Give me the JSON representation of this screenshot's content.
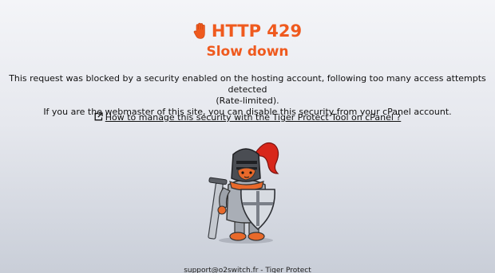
{
  "header": {
    "title": "HTTP 429",
    "subtitle": "Slow down",
    "icon": "hand-stop-icon",
    "accent_color": "#ef5a1e"
  },
  "message": {
    "line1": "This request was blocked by a security enabled on the hosting account, following too many access attempts detected",
    "line2": "(Rate-limited).",
    "line3": "If you are the webmaster of this site, you can disable this security from your cPanel account."
  },
  "help": {
    "icon": "external-link-icon",
    "link_text": "How to manage this security with the Tiger Protect Tool on cPanel ?"
  },
  "mascot": {
    "icon": "tiger-knight-mascot"
  },
  "footer": {
    "text": "support@o2switch.fr - Tiger Protect"
  }
}
